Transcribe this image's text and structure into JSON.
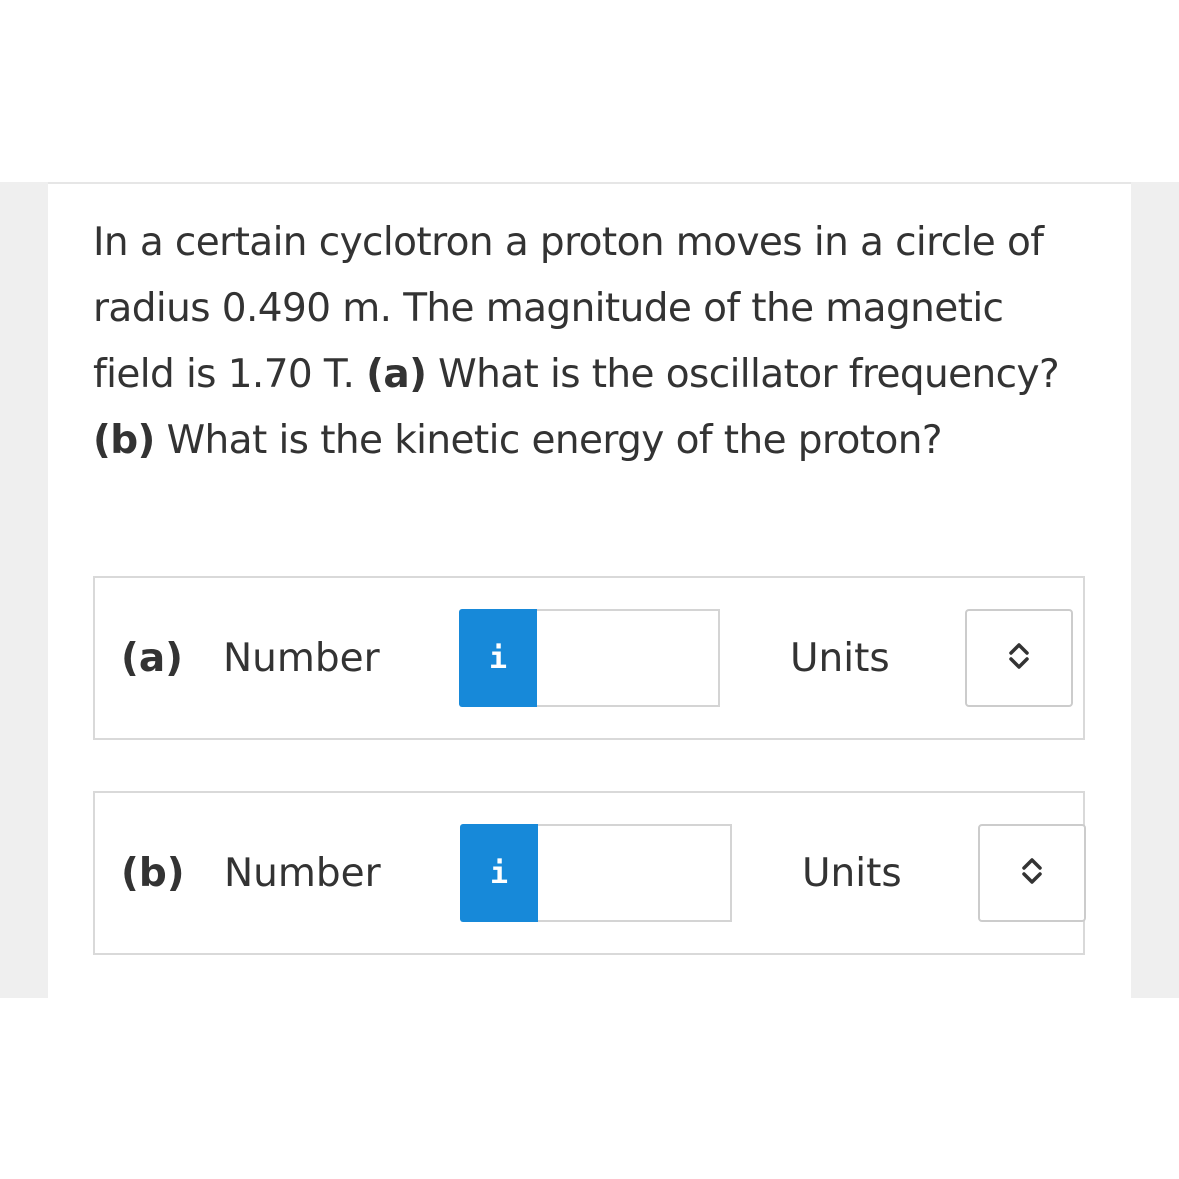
{
  "question": {
    "intro": "In a certain cyclotron a proton moves in a circle of radius 0.490 m. The magnitude of the magnetic field is 1.70 T.",
    "part_a_tag": "(a)",
    "part_a_text": "What is the oscillator frequency?",
    "part_b_tag": "(b)",
    "part_b_text": "What is the kinetic energy of the proton?"
  },
  "answers": [
    {
      "part_label": "(a)",
      "number_label": "Number",
      "info_icon": "i",
      "value": "",
      "units_label": "Units",
      "units_selected": "",
      "select_icon": "chevron-up-down-icon"
    },
    {
      "part_label": "(b)",
      "number_label": "Number",
      "info_icon": "i",
      "value": "",
      "units_label": "Units",
      "units_selected": "",
      "select_icon": "chevron-up-down-icon"
    }
  ],
  "colors": {
    "accent": "#1789d9",
    "text": "#333333",
    "border": "#d9d9d9",
    "gutter": "#efefef"
  }
}
